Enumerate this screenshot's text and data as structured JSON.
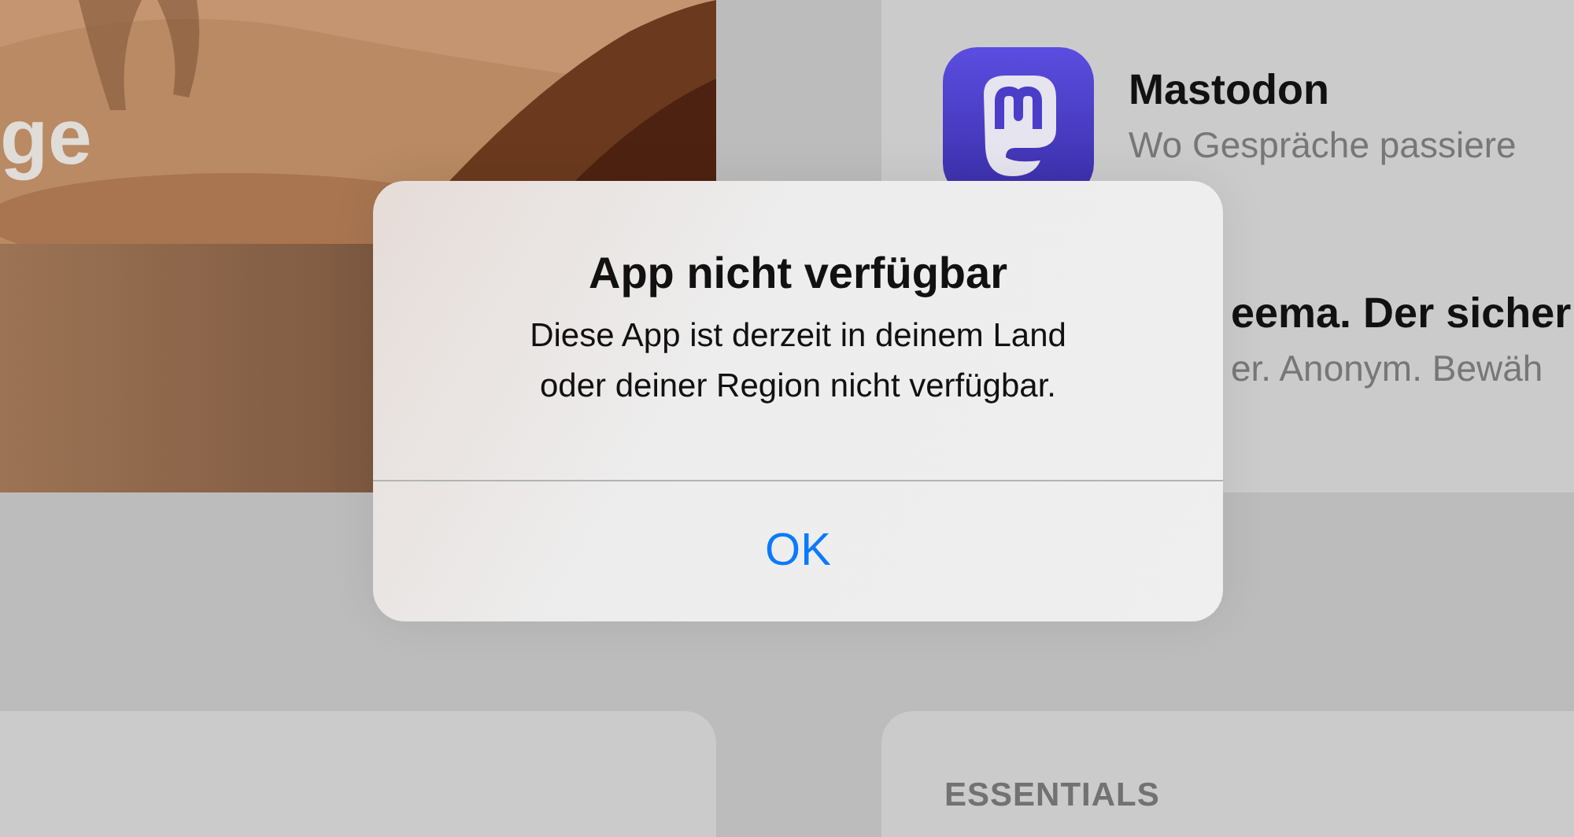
{
  "hero_card": {
    "title": "ge"
  },
  "app_list": [
    {
      "name": "Mastodon",
      "subtitle": "Wo Gespräche passiere",
      "icon_shown": true
    },
    {
      "name": "eema. Der sicher",
      "subtitle": "er. Anonym. Bewäh",
      "icon_shown": false
    }
  ],
  "section": {
    "label": "ESSENTIALS"
  },
  "alert": {
    "title": "App nicht verfügbar",
    "message": "Diese App ist derzeit in deinem Land oder deiner Region nicht verfügbar.",
    "buttons": [
      "OK"
    ]
  }
}
